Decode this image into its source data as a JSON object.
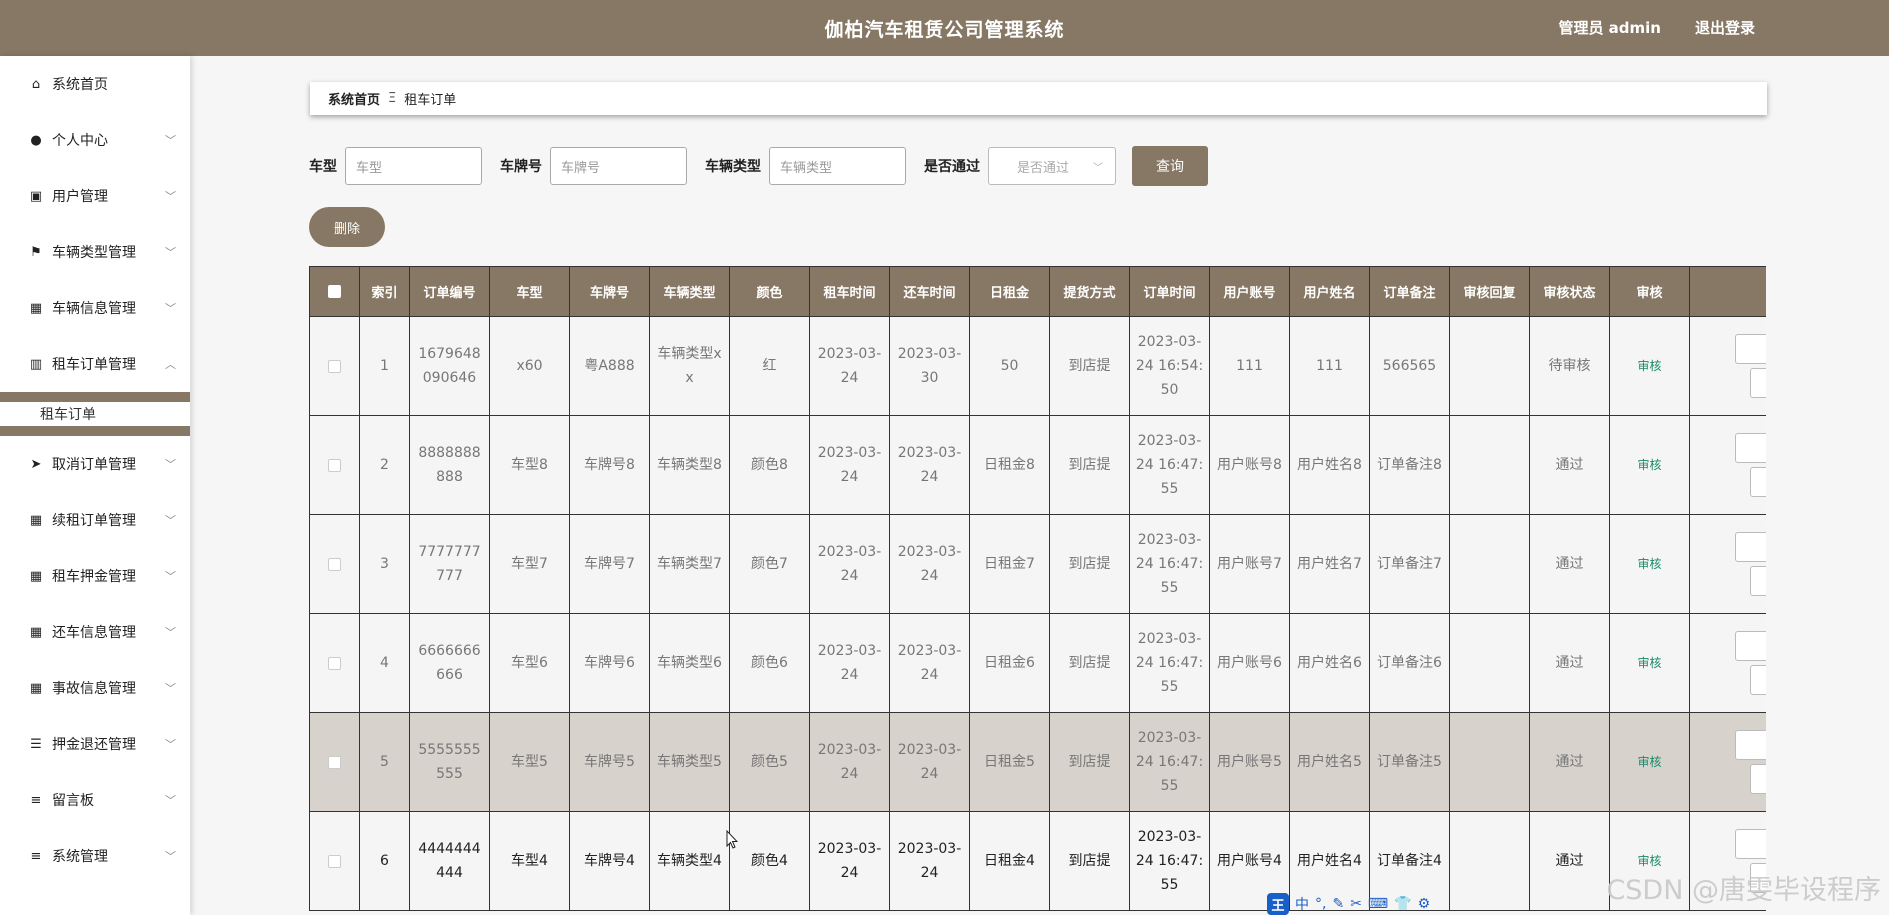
{
  "header": {
    "title": "伽柏汽车租赁公司管理系统",
    "user": "管理员 admin",
    "logout": "退出登录"
  },
  "sidebar": {
    "items": [
      {
        "label": "系统首页",
        "icon": "home-icon",
        "glyph": "⌂",
        "has_chevron": false
      },
      {
        "label": "个人中心",
        "icon": "user-icon",
        "glyph": "●",
        "has_chevron": true
      },
      {
        "label": "用户管理",
        "icon": "clipboard-icon",
        "glyph": "▣",
        "has_chevron": true
      },
      {
        "label": "车辆类型管理",
        "icon": "flag-icon",
        "glyph": "⚑",
        "has_chevron": true
      },
      {
        "label": "车辆信息管理",
        "icon": "grid-icon",
        "glyph": "▦",
        "has_chevron": true
      },
      {
        "label": "租车订单管理",
        "icon": "chart-icon",
        "glyph": "▥",
        "has_chevron": true,
        "expanded": true
      },
      {
        "label": "取消订单管理",
        "icon": "send-icon",
        "glyph": "➤",
        "has_chevron": true
      },
      {
        "label": "续租订单管理",
        "icon": "grid-icon",
        "glyph": "▦",
        "has_chevron": true
      },
      {
        "label": "租车押金管理",
        "icon": "grid-icon",
        "glyph": "▦",
        "has_chevron": true
      },
      {
        "label": "还车信息管理",
        "icon": "grid-icon",
        "glyph": "▦",
        "has_chevron": true
      },
      {
        "label": "事故信息管理",
        "icon": "grid-icon",
        "glyph": "▦",
        "has_chevron": true
      },
      {
        "label": "押金退还管理",
        "icon": "sliders-icon",
        "glyph": "☰",
        "has_chevron": true
      },
      {
        "label": "留言板",
        "icon": "list-icon",
        "glyph": "≡",
        "has_chevron": true
      },
      {
        "label": "系统管理",
        "icon": "list-icon",
        "glyph": "≡",
        "has_chevron": true
      }
    ],
    "submenu_label": "租车订单"
  },
  "breadcrumb": {
    "home": "系统首页",
    "separator": "Ξ",
    "current": "租车订单"
  },
  "filters": {
    "car_model_label": "车型",
    "car_model_placeholder": "车型",
    "plate_label": "车牌号",
    "plate_placeholder": "车牌号",
    "type_label": "车辆类型",
    "type_placeholder": "车辆类型",
    "approved_label": "是否通过",
    "approved_placeholder": "是否通过",
    "query_label": "查询"
  },
  "delete_label": "删除",
  "table": {
    "columns": [
      "索引",
      "订单编号",
      "车型",
      "车牌号",
      "车辆类型",
      "颜色",
      "租车时间",
      "还车时间",
      "日租金",
      "提货方式",
      "订单时间",
      "用户账号",
      "用户姓名",
      "订单备注",
      "审核回复",
      "审核状态",
      "审核"
    ],
    "rows": [
      [
        "1",
        "1679648090646",
        "x60",
        "粤A888",
        "车辆类型xx",
        "红",
        "2023-03-24",
        "2023-03-30",
        "50",
        "到店提",
        "2023-03-24 16:54:50",
        "111",
        "111",
        "566565",
        "",
        "待审核",
        "审核"
      ],
      [
        "2",
        "8888888888",
        "车型8",
        "车牌号8",
        "车辆类型8",
        "颜色8",
        "2023-03-24",
        "2023-03-24",
        "日租金8",
        "到店提",
        "2023-03-24 16:47:55",
        "用户账号8",
        "用户姓名8",
        "订单备注8",
        "",
        "通过",
        "审核"
      ],
      [
        "3",
        "7777777777",
        "车型7",
        "车牌号7",
        "车辆类型7",
        "颜色7",
        "2023-03-24",
        "2023-03-24",
        "日租金7",
        "到店提",
        "2023-03-24 16:47:55",
        "用户账号7",
        "用户姓名7",
        "订单备注7",
        "",
        "通过",
        "审核"
      ],
      [
        "4",
        "6666666666",
        "车型6",
        "车牌号6",
        "车辆类型6",
        "颜色6",
        "2023-03-24",
        "2023-03-24",
        "日租金6",
        "到店提",
        "2023-03-24 16:47:55",
        "用户账号6",
        "用户姓名6",
        "订单备注6",
        "",
        "通过",
        "审核"
      ],
      [
        "5",
        "5555555555",
        "车型5",
        "车牌号5",
        "车辆类型5",
        "颜色5",
        "2023-03-24",
        "2023-03-24",
        "日租金5",
        "到店提",
        "2023-03-24 16:47:55",
        "用户账号5",
        "用户姓名5",
        "订单备注5",
        "",
        "通过",
        "审核"
      ],
      [
        "6",
        "4444444444",
        "车型4",
        "车牌号4",
        "车辆类型4",
        "颜色4",
        "2023-03-24",
        "2023-03-24",
        "日租金4",
        "到店提",
        "2023-03-24 16:47:55",
        "用户账号4",
        "用户姓名4",
        "订单备注4",
        "",
        "通过",
        "审核"
      ]
    ]
  },
  "watermark": "CSDN @唐雯毕设程序",
  "ime": {
    "logo": "王",
    "mode": "中",
    "icons": [
      "°,",
      "✎",
      "✂",
      "⌨",
      "👕",
      "⚙"
    ]
  },
  "colors": {
    "brand": "#877865",
    "audit_link": "#1a8a6a",
    "ime": "#1a5fc7"
  }
}
